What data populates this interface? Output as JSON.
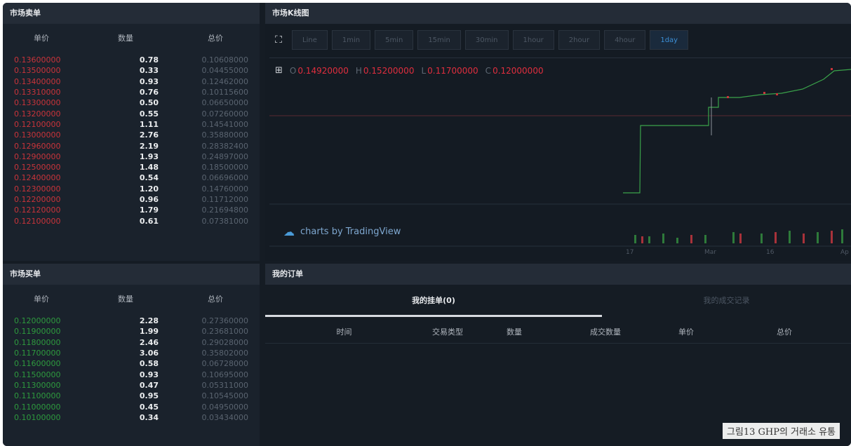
{
  "sell": {
    "title": "市场卖单",
    "columns": [
      "单价",
      "数量",
      "总价"
    ],
    "rows": [
      [
        "0.13600000",
        "0.78",
        "0.10608000"
      ],
      [
        "0.13500000",
        "0.33",
        "0.04455000"
      ],
      [
        "0.13400000",
        "0.93",
        "0.12462000"
      ],
      [
        "0.13310000",
        "0.76",
        "0.10115600"
      ],
      [
        "0.13300000",
        "0.50",
        "0.06650000"
      ],
      [
        "0.13200000",
        "0.55",
        "0.07260000"
      ],
      [
        "0.12100000",
        "1.11",
        "0.14541000"
      ],
      [
        "0.13000000",
        "2.76",
        "0.35880000"
      ],
      [
        "0.12960000",
        "2.19",
        "0.28382400"
      ],
      [
        "0.12900000",
        "1.93",
        "0.24897000"
      ],
      [
        "0.12500000",
        "1.48",
        "0.18500000"
      ],
      [
        "0.12400000",
        "0.54",
        "0.06696000"
      ],
      [
        "0.12300000",
        "1.20",
        "0.14760000"
      ],
      [
        "0.12200000",
        "0.96",
        "0.11712000"
      ],
      [
        "0.12120000",
        "1.79",
        "0.21694800"
      ],
      [
        "0.12100000",
        "0.61",
        "0.07381000"
      ]
    ]
  },
  "buy": {
    "title": "市场买单",
    "columns": [
      "单价",
      "数量",
      "总价"
    ],
    "rows": [
      [
        "0.12000000",
        "2.28",
        "0.27360000"
      ],
      [
        "0.11900000",
        "1.99",
        "0.23681000"
      ],
      [
        "0.11800000",
        "2.46",
        "0.29028000"
      ],
      [
        "0.11700000",
        "3.06",
        "0.35802000"
      ],
      [
        "0.11600000",
        "0.58",
        "0.06728000"
      ],
      [
        "0.11500000",
        "0.93",
        "0.10695000"
      ],
      [
        "0.11300000",
        "0.47",
        "0.05311000"
      ],
      [
        "0.11100000",
        "0.95",
        "0.10545000"
      ],
      [
        "0.11000000",
        "0.45",
        "0.04950000"
      ],
      [
        "0.10100000",
        "0.34",
        "0.03434000"
      ]
    ]
  },
  "chart": {
    "title": "市场K线图",
    "intervals": [
      "Line",
      "1min",
      "5min",
      "15min",
      "30min",
      "1hour",
      "2hour",
      "4hour",
      "1day"
    ],
    "active_interval": "1day",
    "ohlc": {
      "o": "0.14920000",
      "h": "0.15200000",
      "l": "0.11700000",
      "c": "0.12000000"
    },
    "ohlc_labels": {
      "o": "O",
      "h": "H",
      "l": "L",
      "c": "C"
    },
    "branding": "charts by TradingView",
    "x_ticks": [
      "17",
      "Mar",
      "16",
      "Ap"
    ],
    "colors": {
      "up": "#2e9a3e",
      "down": "#c9343a"
    }
  },
  "orders": {
    "title": "我的订单",
    "tabs": [
      "我的挂单(0)",
      "我的成交记录"
    ],
    "columns": [
      "时间",
      "交易类型",
      "数量",
      "成交数量",
      "单价",
      "总价"
    ]
  },
  "caption": "그림13 GHP의 거래소 유통"
}
